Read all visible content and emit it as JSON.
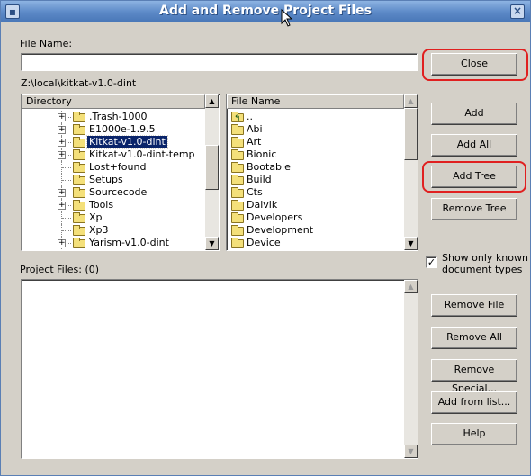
{
  "window": {
    "title": "Add and Remove Project Files"
  },
  "filename": {
    "label": "File Name:",
    "value": ""
  },
  "current_path": "Z:\\local\\kitkat-v1.0-dint",
  "directory_tree": {
    "header": "Directory",
    "items": [
      {
        "label": ".Trash-1000",
        "expandable": true
      },
      {
        "label": "E1000e-1.9.5",
        "expandable": true
      },
      {
        "label": "Kitkat-v1.0-dint",
        "expandable": true,
        "selected": true
      },
      {
        "label": "Kitkat-v1.0-dint-temp",
        "expandable": true
      },
      {
        "label": "Lost+found",
        "expandable": false
      },
      {
        "label": "Setups",
        "expandable": false
      },
      {
        "label": "Sourcecode",
        "expandable": true
      },
      {
        "label": "Tools",
        "expandable": true
      },
      {
        "label": "Xp",
        "expandable": false
      },
      {
        "label": "Xp3",
        "expandable": false
      },
      {
        "label": "Yarism-v1.0-dint",
        "expandable": true
      }
    ]
  },
  "file_list": {
    "header": "File Name",
    "items": [
      {
        "label": "..",
        "up": true
      },
      {
        "label": "Abi"
      },
      {
        "label": "Art"
      },
      {
        "label": "Bionic"
      },
      {
        "label": "Bootable"
      },
      {
        "label": "Build"
      },
      {
        "label": "Cts"
      },
      {
        "label": "Dalvik"
      },
      {
        "label": "Developers"
      },
      {
        "label": "Development"
      },
      {
        "label": "Device"
      }
    ]
  },
  "project_files": {
    "label": "Project Files: (0)",
    "items": []
  },
  "options": {
    "show_only_known": {
      "label_line1": "Show only known",
      "label_line2": "document types",
      "checked": true,
      "check_glyph": "✓"
    }
  },
  "buttons": {
    "close": "Close",
    "add": "Add",
    "add_all": "Add All",
    "add_tree": "Add Tree",
    "remove_tree": "Remove Tree",
    "remove_file": "Remove File",
    "remove_all": "Remove All",
    "remove_special": "Remove Special...",
    "add_from_list": "Add from list...",
    "help": "Help"
  },
  "icons": {
    "window_icon": "window-icon",
    "close": "close-icon",
    "scroll_up": "▲",
    "scroll_down": "▼",
    "expand": "+",
    "win_close_glyph": "×"
  },
  "colors": {
    "titlebar": "#5c89c7",
    "selection": "#0a246a",
    "highlight_annotation": "#e02020"
  }
}
